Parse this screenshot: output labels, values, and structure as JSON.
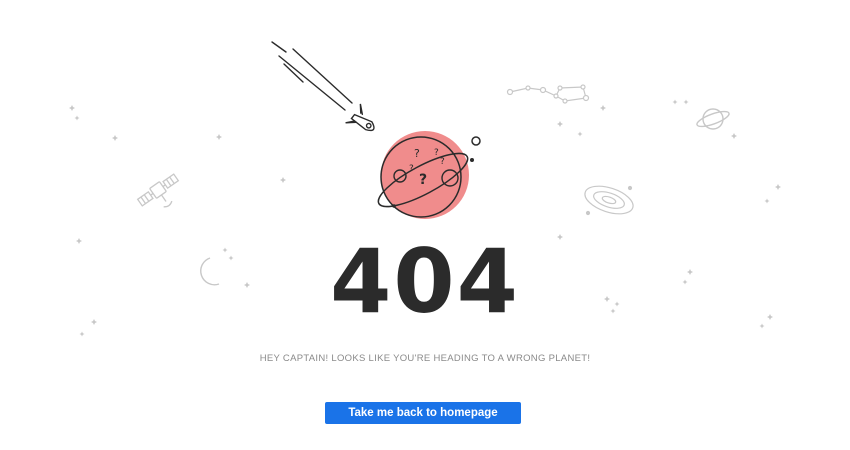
{
  "error": {
    "code": "404",
    "message": "HEY CAPTAIN! LOOKS LIKE YOU'RE HEADING TO A WRONG PLANET!"
  },
  "actions": {
    "home_label": "Take me back to homepage"
  },
  "planet": {
    "marks": [
      "?",
      "?",
      "?",
      "?",
      "?"
    ]
  },
  "colors": {
    "button": "#1a73e8",
    "planet": "#f08c8c",
    "heading": "#2b2b2b",
    "decor": "#c8c8c8"
  },
  "icons": [
    "rocket-icon",
    "planet-icon",
    "satellite-icon",
    "moon-icon",
    "ringed-planet-icon",
    "galaxy-icon",
    "constellation-icon",
    "star-icon"
  ]
}
